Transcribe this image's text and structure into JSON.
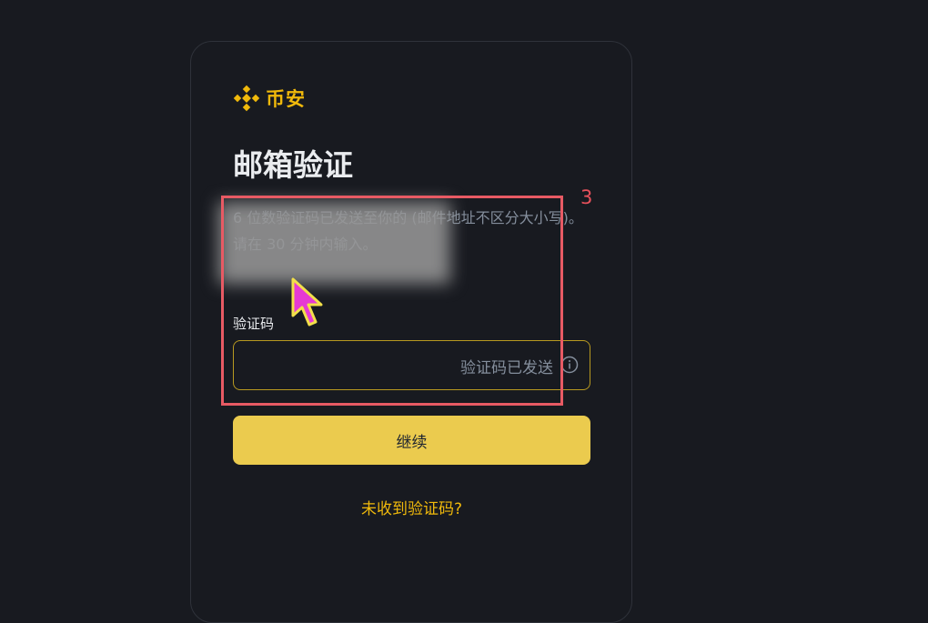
{
  "brand": {
    "name": "币安",
    "logo_icon": "binance-diamond-icon",
    "color": "#f0b90b"
  },
  "page": {
    "title": "邮箱验证",
    "description": "6 位数验证码已发送至你的 (邮件地址不区分大小写)。请在 30 分钟内输入。"
  },
  "verification": {
    "label": "验证码",
    "value": "",
    "status_text": "验证码已发送",
    "status_icon": "info-icon"
  },
  "actions": {
    "continue_label": "继续",
    "resend_label": "未收到验证码?"
  },
  "annotation": {
    "step_number": "3",
    "highlight_color": "#e85a64",
    "cursor_icon": "pointer-cursor-icon"
  },
  "colors": {
    "background": "#181a20",
    "button": "#ebcb4e",
    "link": "#f0b90b",
    "input_border": "#b89920"
  }
}
